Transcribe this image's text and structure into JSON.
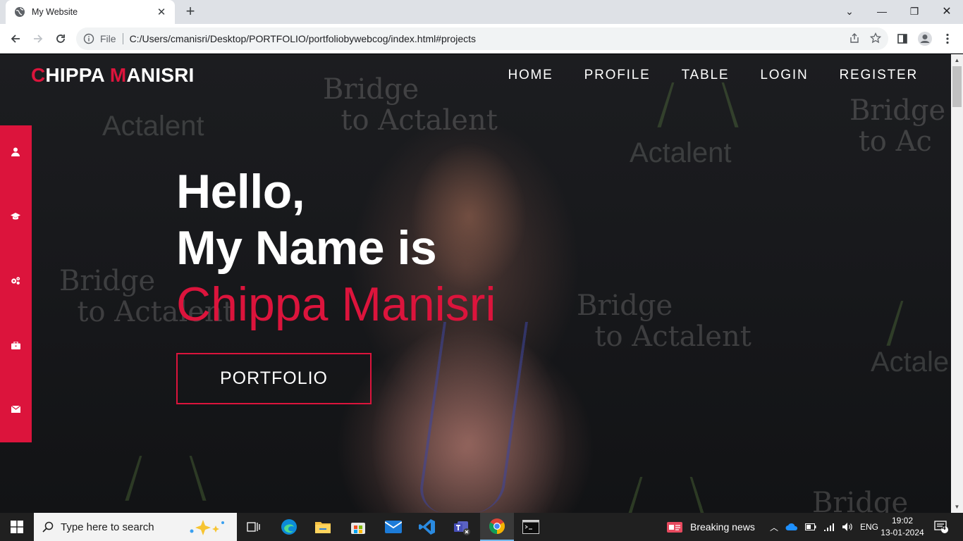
{
  "browser": {
    "tab_title": "My Website",
    "tab_close": "✕",
    "new_tab": "+",
    "scheme_label": "File",
    "url": "C:/Users/cmanisri/Desktop/PORTFOLIO/portfoliobywebcog/index.html#projects",
    "win_min": "—",
    "win_restore": "❐",
    "win_close": "✕",
    "win_dropdown": "⌄"
  },
  "site": {
    "logo_c": "C",
    "logo_rest1": "HIPPA ",
    "logo_m": "M",
    "logo_rest2": "ANISRI",
    "nav": [
      "HOME",
      "PROFILE",
      "TABLE",
      "LOGIN",
      "REGISTER"
    ],
    "hero_line1": "Hello,",
    "hero_line2": "My Name is",
    "hero_name": "Chippa Manisri",
    "cta": "PORTFOLIO",
    "sidebar_icons": [
      "user-icon",
      "graduation-cap-icon",
      "cogs-icon",
      "briefcase-icon",
      "envelope-icon"
    ],
    "accent": "#dc143c"
  },
  "taskbar": {
    "search_placeholder": "Type here to search",
    "news": "Breaking news",
    "lang": "ENG",
    "time": "19:02",
    "date": "13-01-2024",
    "notif_count": "4"
  }
}
